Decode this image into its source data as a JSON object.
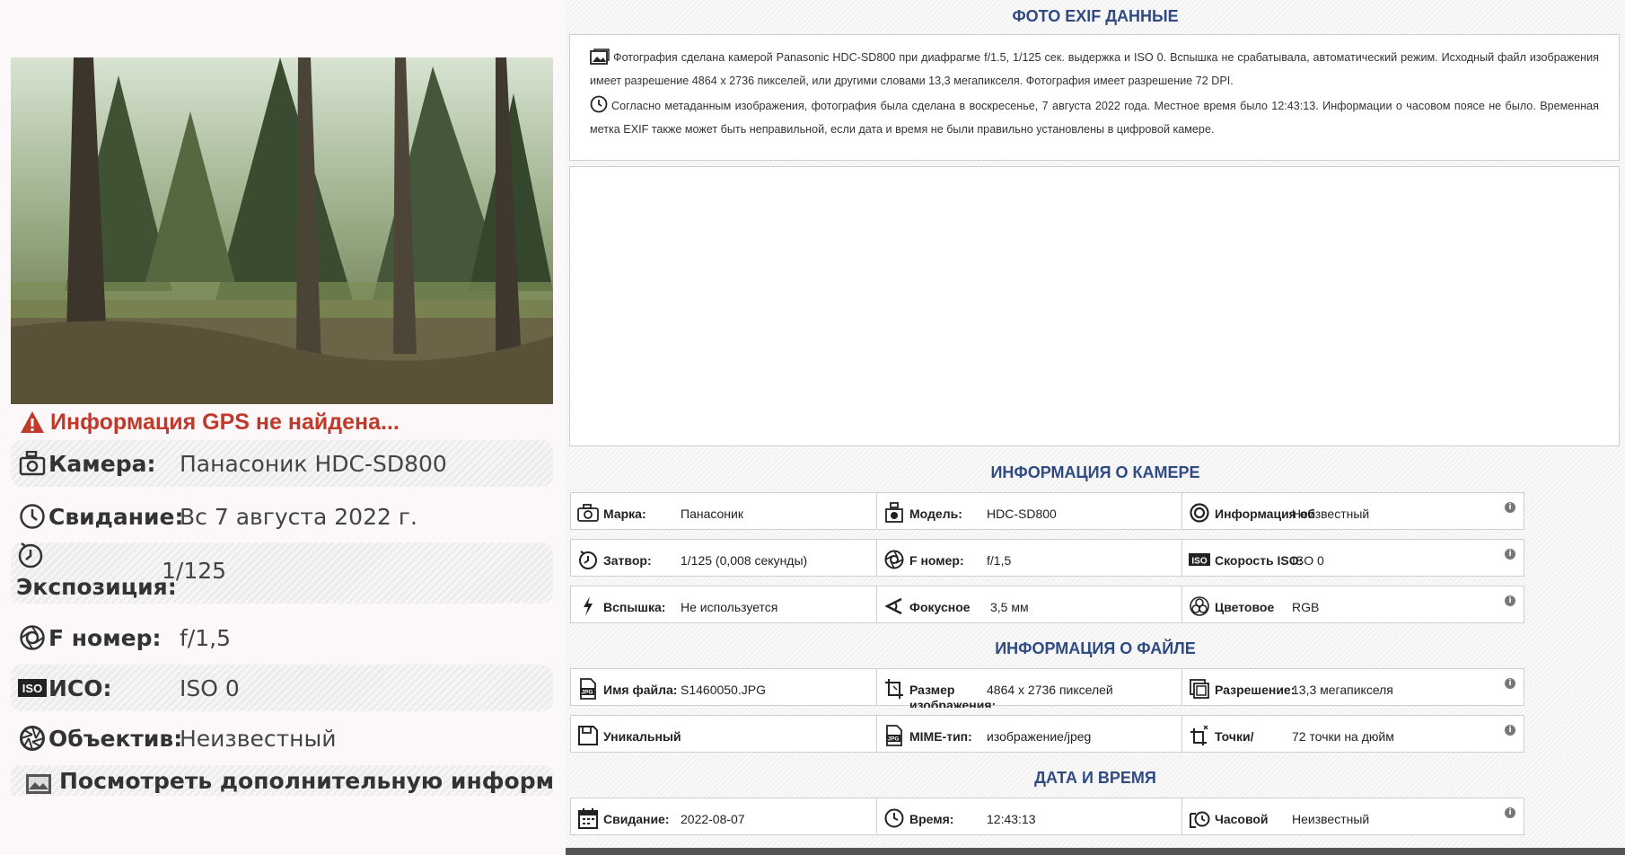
{
  "left": {
    "gps_warning": "Информация GPS не найдена...",
    "rows": [
      {
        "icon": "camera-icon",
        "label": "Камера:",
        "value": "Панасоник HDC-SD800"
      },
      {
        "icon": "clock-icon",
        "label": "Свидание:",
        "value": "Вс 7 августа 2022 г."
      },
      {
        "icon": "timer-icon",
        "label": "Экспозиция:",
        "value": "1/125"
      },
      {
        "icon": "aperture-icon",
        "label": "F номер:",
        "value": "f/1,5"
      },
      {
        "icon": "iso-icon",
        "label": "ИСО:",
        "value": "ISO 0"
      },
      {
        "icon": "lens-icon",
        "label": "Объектив:",
        "value": "Неизвестный"
      }
    ],
    "more_link": "Посмотреть дополнительную информацию"
  },
  "right": {
    "title": "ФОТО EXIF ДАННЫЕ",
    "desc1": "Фотография сделана камерой Panasonic HDC-SD800 при диафрагме f/1.5, 1/125 сек. выдержка и ISO 0. Вспышка не срабатывала, автоматический режим. Исходный файл изображения имеет разрешение 4864 x 2736 пикселей, или другими словами 13,3 мегапикселя. Фотография имеет разрешение 72 DPI.",
    "desc2": "Согласно метаданным изображения, фотография была сделана в воскресенье, 7 августа 2022 года. Местное время было 12:43:13. Информации о часовом поясе не было. Временная метка EXIF также может быть неправильной, если дата и время не были правильно установлены в цифровой камере.",
    "camera_title": "ИНФОРМАЦИЯ О КАМЕРЕ",
    "camera": [
      {
        "icon": "camera-icon",
        "label": "Марка:",
        "value": "Панасоник"
      },
      {
        "icon": "camcorder-icon",
        "label": "Модель:",
        "value": "HDC-SD800"
      },
      {
        "icon": "lens-icon",
        "label": "Информация об",
        "value": "Неизвестный"
      },
      {
        "icon": "timer-icon",
        "label": "Затвор:",
        "value": "1/125 (0,008 секунды)"
      },
      {
        "icon": "aperture-icon",
        "label": "F номер:",
        "value": "f/1,5"
      },
      {
        "icon": "iso-icon",
        "label": "Скорость ISO:",
        "value": "ISO 0"
      },
      {
        "icon": "flash-icon",
        "label": "Вспышка:",
        "value": "Не используется"
      },
      {
        "icon": "focal-icon",
        "label": "Фокусное",
        "value": "3,5 мм"
      },
      {
        "icon": "color-icon",
        "label": "Цветовое",
        "value": "RGB"
      }
    ],
    "file_title": "ИНФОРМАЦИЯ О ФАЙЛЕ",
    "file": [
      {
        "icon": "jpg-icon",
        "label": "Имя файла:",
        "value": "S1460050.JPG"
      },
      {
        "icon": "crop-icon",
        "label": "Размер изображения:",
        "value": "4864 x 2736 пикселей"
      },
      {
        "icon": "layers-icon",
        "label": "Разрешение:",
        "value": "13,3 мегапикселя"
      },
      {
        "icon": "save-icon",
        "label": "Уникальный",
        "value": ""
      },
      {
        "icon": "jpg-icon",
        "label": "MIME-тип:",
        "value": "изображение/jpeg"
      },
      {
        "icon": "dpi-icon",
        "label": "Точки/",
        "value": "72 точки на дюйм"
      }
    ],
    "date_title": "ДАТА И ВРЕМЯ",
    "date": [
      {
        "icon": "calendar-icon",
        "label": "Свидание:",
        "value": "2022-08-07"
      },
      {
        "icon": "clock-icon",
        "label": "Время:",
        "value": "12:43:13"
      },
      {
        "icon": "timezone-icon",
        "label": "Часовой",
        "value": "Неизвестный"
      }
    ]
  }
}
